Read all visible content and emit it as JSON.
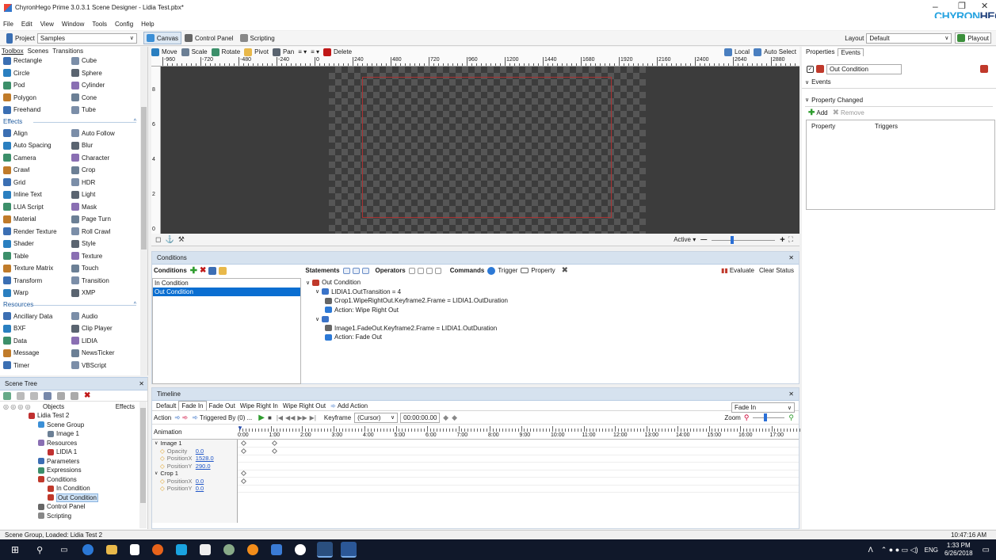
{
  "window": {
    "title": "ChyronHego Prime 3.0.3.1 Scene Designer - Lidia Test.pbx*",
    "brand_a": "CHYRON",
    "brand_b": "HEGO",
    "minimize": "–",
    "restore": "❐",
    "close": "✕"
  },
  "menu": [
    "File",
    "Edit",
    "View",
    "Window",
    "Tools",
    "Config",
    "Help"
  ],
  "project": {
    "label": "Project",
    "value": "Samples"
  },
  "tabs_top": [
    {
      "label": "Canvas",
      "selected": true
    },
    {
      "label": "Control Panel",
      "selected": false
    },
    {
      "label": "Scripting",
      "selected": false
    }
  ],
  "layout": {
    "label": "Layout",
    "value": "Default",
    "playout": "Playout"
  },
  "toolbox_tabs": [
    "Toolbox",
    "Scenes",
    "Transitions"
  ],
  "shapes": [
    "Rectangle",
    "Cube",
    "Circle",
    "Sphere",
    "Pod",
    "Cylinder",
    "Polygon",
    "Cone",
    "Freehand",
    "Tube"
  ],
  "effects_header": "Effects",
  "effects": [
    "Align",
    "Auto Follow",
    "Auto Spacing",
    "Blur",
    "Camera",
    "Character",
    "Crawl",
    "Crop",
    "Grid",
    "HDR",
    "Inline Text",
    "Light",
    "LUA Script",
    "Mask",
    "Material",
    "Page Turn",
    "Render Texture",
    "Roll Crawl",
    "Shader",
    "Style",
    "Table",
    "Texture",
    "Texture Matrix",
    "Touch",
    "Transform",
    "Transition",
    "Warp",
    "XMP"
  ],
  "resources_header": "Resources",
  "resources": [
    "Ancillary Data",
    "Audio",
    "BXF",
    "Clip Player",
    "Data",
    "LIDIA",
    "Message",
    "NewsTicker",
    "Timer",
    "VBScript"
  ],
  "canvas_toolbar": [
    "Move",
    "Scale",
    "Rotate",
    "Pivot",
    "Pan",
    "Delete"
  ],
  "canvas_toolbar_right": [
    "Local",
    "Auto Select"
  ],
  "ruler_labels": [
    "-960",
    "-720",
    "-480",
    "-240",
    "0",
    "240",
    "480",
    "720",
    "960",
    "1200",
    "1440",
    "1680",
    "1920",
    "2160",
    "2400",
    "2640",
    "2880"
  ],
  "vruler_labels": [
    "8",
    "6",
    "4",
    "2",
    "0"
  ],
  "canvas_bottom": {
    "active": "Active",
    "zoom_minus": "—",
    "zoom_plus": "+"
  },
  "scene_tree": {
    "title": "Scene Tree",
    "col_objects": "Objects",
    "col_effects": "Effects",
    "items": [
      {
        "label": "Lidia Test 2",
        "indent": 1
      },
      {
        "label": "Scene Group",
        "indent": 2
      },
      {
        "label": "Image 1",
        "indent": 3
      },
      {
        "label": "Resources",
        "indent": 2
      },
      {
        "label": "LIDIA 1",
        "indent": 3
      },
      {
        "label": "Parameters",
        "indent": 2
      },
      {
        "label": "Expressions",
        "indent": 2
      },
      {
        "label": "Conditions",
        "indent": 2
      },
      {
        "label": "In Condition",
        "indent": 3
      },
      {
        "label": "Out Condition",
        "indent": 3,
        "selected": true
      },
      {
        "label": "Control Panel",
        "indent": 2
      },
      {
        "label": "Scripting",
        "indent": 2
      }
    ]
  },
  "conditions": {
    "panel_title": "Conditions",
    "label": "Conditions",
    "list": [
      {
        "label": "In Condition",
        "selected": false
      },
      {
        "label": "Out Condition",
        "selected": true
      }
    ],
    "statements_label": "Statements",
    "operators_label": "Operators",
    "commands_label": "Commands",
    "trigger": "Trigger",
    "property": "Property",
    "evaluate": "Evaluate",
    "clear_status": "Clear Status",
    "tree": [
      {
        "text": "Out Condition",
        "indent": 0
      },
      {
        "text": "LIDIA1.OutTransition = 4",
        "indent": 1
      },
      {
        "text": "Crop1.WipeRightOut.Keyframe2.Frame = LIDIA1.OutDuration",
        "indent": 2
      },
      {
        "text": "Action: Wipe Right Out",
        "indent": 2
      },
      {
        "text": "",
        "indent": 1
      },
      {
        "text": "Image1.FadeOut.Keyframe2.Frame = LIDIA1.OutDuration",
        "indent": 2
      },
      {
        "text": "Action: Fade Out",
        "indent": 2
      }
    ]
  },
  "properties_panel": {
    "tabs": [
      "Properties",
      "Events"
    ],
    "object": "Out Condition",
    "events": "Events",
    "property_changed": "Property Changed",
    "add": "Add",
    "remove": "Remove",
    "col_property": "Property",
    "col_triggers": "Triggers"
  },
  "timeline": {
    "title": "Timeline",
    "tabs": [
      "Default",
      "Fade In",
      "Fade Out",
      "Wipe Right In",
      "Wipe Right Out",
      "Add Action"
    ],
    "selected_tab": "Fade In",
    "dropdown": "Fade In",
    "action": "Action",
    "triggered_by": "Triggered By (0) ...",
    "keyframe": "Keyframe",
    "keyframe_mode": "(Cursor)",
    "timecode": "00:00:00.00",
    "zoom": "Zoom",
    "animation": "Animation",
    "ticks": [
      "0:00",
      "1:00",
      "2:00",
      "3:00",
      "4:00",
      "5:00",
      "6:00",
      "7:00",
      "8:00",
      "9:00",
      "10:00",
      "11:00",
      "12:00",
      "13:00",
      "14:00",
      "15:00",
      "16:00",
      "17:00"
    ],
    "tracks": [
      {
        "name": "Image 1",
        "group": true
      },
      {
        "name": "Opacity",
        "value": "0.0"
      },
      {
        "name": "PositionX",
        "value": "1528.0"
      },
      {
        "name": "PositionY",
        "value": "290.0"
      },
      {
        "name": "Crop 1",
        "group": true
      },
      {
        "name": "PositionX",
        "value": "0.0"
      },
      {
        "name": "PositionY",
        "value": "0.0"
      }
    ]
  },
  "status": {
    "left": "Scene Group, Loaded: Lidia Test 2",
    "right": "10:47:16 AM"
  },
  "taskbar": {
    "lang": "ENG",
    "time": "1:33 PM",
    "date": "6/26/2018"
  }
}
